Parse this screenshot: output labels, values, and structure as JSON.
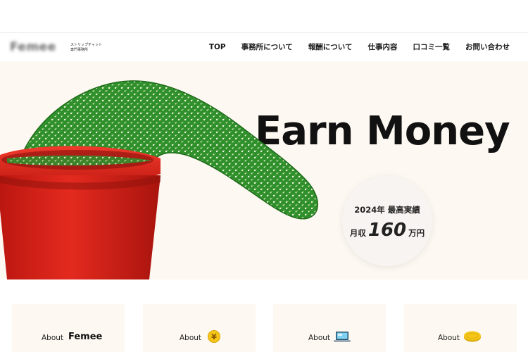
{
  "header": {
    "logo_text": "Femee",
    "logo_tagline": "ストリップチャット\n専門事務所",
    "nav": [
      "TOP",
      "事務所について",
      "報酬について",
      "仕事内容",
      "口コミ一覧",
      "お問い合わせ"
    ]
  },
  "hero": {
    "headline": "Earn Money",
    "badge": {
      "line1": "2024年 最高実績",
      "prefix": "月収",
      "amount": "160",
      "suffix": "万円"
    }
  },
  "cards": [
    {
      "label": "About",
      "name": "Femee",
      "icon": "text-logo"
    },
    {
      "label": "About",
      "icon": "yen-coin-icon",
      "icon_text": "¥"
    },
    {
      "label": "About",
      "icon": "laptop-icon"
    },
    {
      "label": "About",
      "icon": "coin-icon"
    }
  ],
  "colors": {
    "hero_bg": "#fdf8f1",
    "pot_red": "#d8231a",
    "cactus_green": "#2f8f2a",
    "coin_yellow": "#f5c518"
  }
}
